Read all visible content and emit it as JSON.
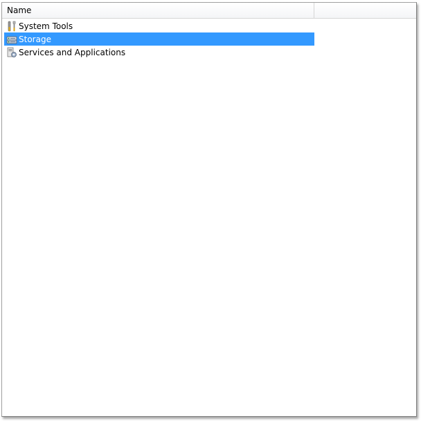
{
  "header": {
    "name_column": "Name"
  },
  "items": [
    {
      "label": "System Tools",
      "icon": "tools-icon",
      "selected": false
    },
    {
      "label": "Storage",
      "icon": "storage-icon",
      "selected": true
    },
    {
      "label": "Services and Applications",
      "icon": "services-icon",
      "selected": false
    }
  ],
  "colors": {
    "selection": "#3399ff",
    "selection_text": "#ffffff"
  }
}
